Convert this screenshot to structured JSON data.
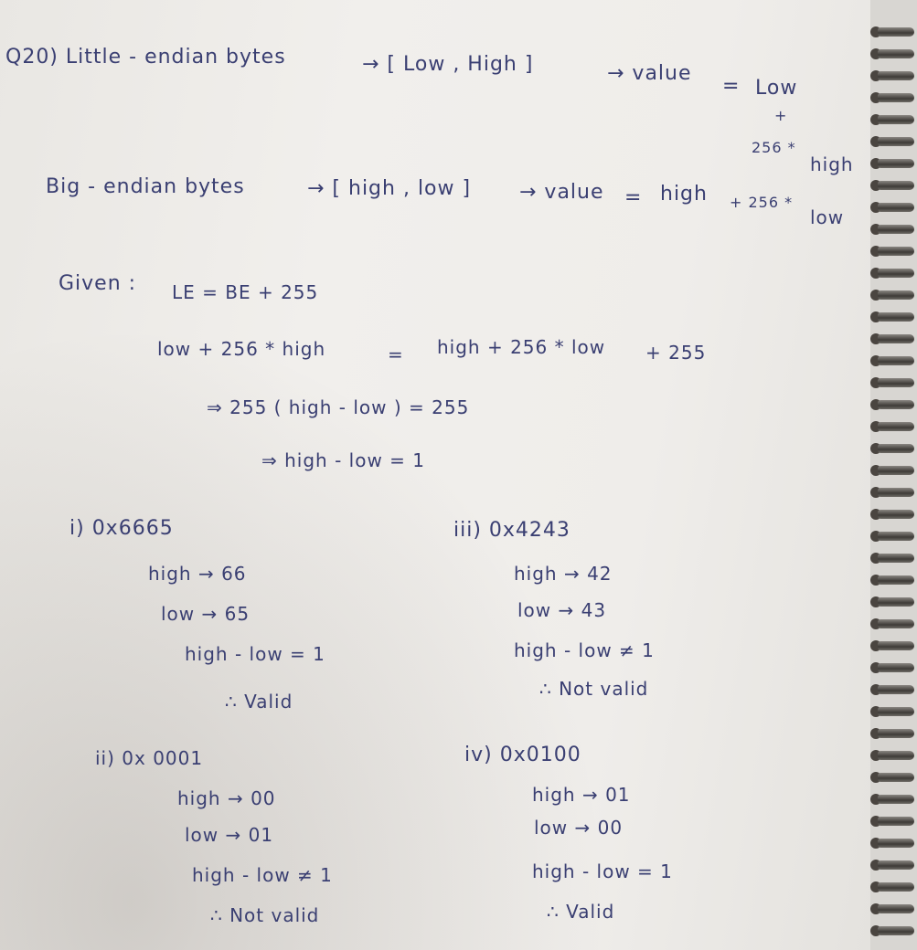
{
  "notes": {
    "line1": {
      "question": "Q20) Little - endian bytes",
      "arrow_bytes": "→ [ Low , High ]",
      "arrow_value": "→ value",
      "eq": "=",
      "low": "Low",
      "plus": "+",
      "mult": "256 *",
      "high": "high"
    },
    "line2": {
      "label": "Big - endian bytes",
      "arrow_bytes": "→ [ high , low ]",
      "arrow_value": "→ value",
      "eq": "=",
      "high": "high",
      "mult": "+ 256 *",
      "low": "low"
    },
    "given": {
      "label": "Given :",
      "eq1": "LE = BE + 255",
      "eq2_left": "low + 256 * high",
      "eq2_mid": "=",
      "eq2_right": "high + 256 * low",
      "eq2_tail": "+ 255",
      "eq3": "⇒ 255 ( high - low ) = 255",
      "eq4": "⇒ high - low = 1"
    },
    "cases": [
      {
        "title": "i) 0x6665",
        "high": "high → 66",
        "low": "low → 65",
        "check": "high - low = 1",
        "result": "∴ Valid"
      },
      {
        "title": "iii) 0x4243",
        "high": "high → 42",
        "low": "low → 43",
        "check": "high - low ≠ 1",
        "result": "∴ Not valid"
      },
      {
        "title": "ii) 0x 0001",
        "high": "high → 00",
        "low": "low → 01",
        "check": "high - low ≠ 1",
        "result": "∴ Not valid"
      },
      {
        "title": "iv) 0x0100",
        "high": "high → 01",
        "low": "low → 00",
        "check": "high - low = 1",
        "result": "∴ Valid"
      }
    ]
  },
  "colors": {
    "ink": "#3a3f72",
    "paper": "#efedea"
  }
}
